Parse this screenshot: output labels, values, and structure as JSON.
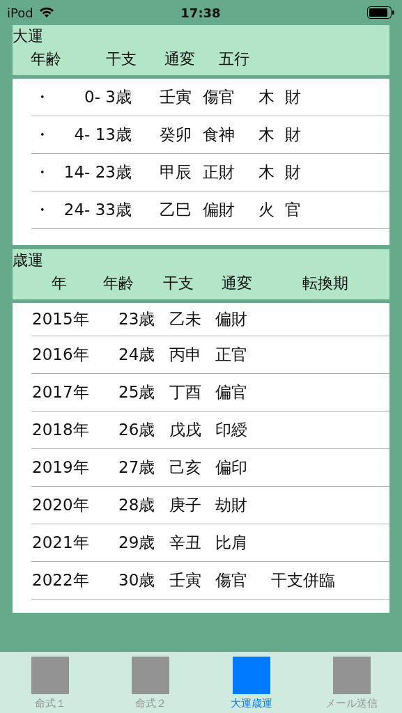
{
  "status_bar": {
    "carrier": "iPod",
    "time": "17:38"
  },
  "daiun": {
    "title": "大運",
    "columns": [
      "年齢",
      "干支",
      "通変",
      "五行"
    ],
    "rows": [
      {
        "mark": "・",
        "age": "0- 3歳",
        "kanshi": "壬寅",
        "tsuhen": "傷官",
        "gogyo": "木",
        "extra": "財"
      },
      {
        "mark": "・",
        "age": "4- 13歳",
        "kanshi": "癸卯",
        "tsuhen": "食神",
        "gogyo": "木",
        "extra": "財"
      },
      {
        "mark": "・",
        "age": "14- 23歳",
        "kanshi": "甲辰",
        "tsuhen": "正財",
        "gogyo": "木",
        "extra": "財"
      },
      {
        "mark": "・",
        "age": "24- 33歳",
        "kanshi": "乙巳",
        "tsuhen": "偏財",
        "gogyo": "火",
        "extra": "官"
      }
    ]
  },
  "saiun": {
    "title": "歳運",
    "columns": [
      "年",
      "年齢",
      "干支",
      "通変",
      "転換期"
    ],
    "rows": [
      {
        "year": "2015年",
        "age": "23歳",
        "kanshi": "乙未",
        "tsuhen": "偏財"
      },
      {
        "year": "2016年",
        "age": "24歳",
        "kanshi": "丙申",
        "tsuhen": "正官"
      },
      {
        "year": "2017年",
        "age": "25歳",
        "kanshi": "丁酉",
        "tsuhen": "偏官"
      },
      {
        "year": "2018年",
        "age": "26歳",
        "kanshi": "戊戌",
        "tsuhen": "印綬"
      },
      {
        "year": "2019年",
        "age": "27歳",
        "kanshi": "己亥",
        "tsuhen": "偏印"
      },
      {
        "year": "2020年",
        "age": "28歳",
        "kanshi": "庚子",
        "tsuhen": "劫財"
      },
      {
        "year": "2021年",
        "age": "29歳",
        "kanshi": "辛丑",
        "tsuhen": "比肩"
      },
      {
        "year": "2022年",
        "age": "30歳",
        "kanshi": "壬寅",
        "tsuhen": "傷官",
        "turning": "干支併臨"
      }
    ]
  },
  "tabs": [
    {
      "label": "命式１",
      "selected": false
    },
    {
      "label": "命式２",
      "selected": false
    },
    {
      "label": "大運歳運",
      "selected": true
    },
    {
      "label": "メール送信",
      "selected": false
    }
  ]
}
